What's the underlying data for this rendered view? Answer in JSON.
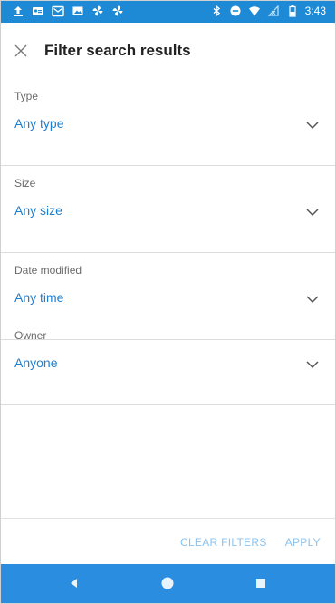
{
  "status_bar": {
    "time": "3:43",
    "left_icons": [
      "upload-icon",
      "contact-card-icon",
      "gmail-icon",
      "image-icon",
      "pinwheel-icon",
      "pinwheel-icon"
    ],
    "right_icons": [
      "bluetooth-icon",
      "do-not-disturb-icon",
      "wifi-icon",
      "no-signal-icon",
      "battery-icon"
    ],
    "color": "#1e8ad6"
  },
  "header": {
    "title": "Filter search results",
    "close_icon": "close-icon"
  },
  "filters": [
    {
      "label": "Type",
      "value": "Any type"
    },
    {
      "label": "Size",
      "value": "Any size"
    },
    {
      "label": "Date modified",
      "value": "Any time"
    },
    {
      "label": "Owner",
      "value": "Anyone"
    }
  ],
  "footer": {
    "clear_label": "CLEAR FILTERS",
    "apply_label": "APPLY"
  },
  "nav_bar": {
    "buttons": [
      "back-icon",
      "home-icon",
      "recents-icon"
    ],
    "color": "#2b8de0"
  },
  "colors": {
    "accent": "#1e7fcf",
    "muted_action": "#8cc3ee"
  }
}
